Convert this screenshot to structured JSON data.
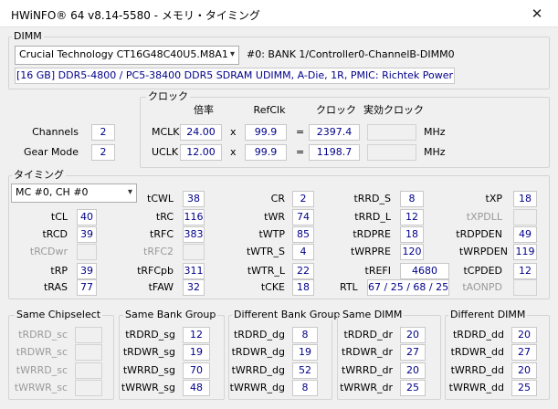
{
  "window": {
    "title": "HWiNFO® 64 v8.14-5580 - メモリ・タイミング",
    "close_glyph": "✕"
  },
  "dimm": {
    "label": "DIMM",
    "selected_module": "Crucial Technology CT16G48C40U5.M8A1",
    "location": "#0: BANK 1/Controller0-ChannelB-DIMM0",
    "description": "[16 GB] DDR5-4800 / PC5-38400 DDR5 SDRAM UDIMM, A-Die, 1R, PMIC: Richtek Power"
  },
  "general": {
    "channels_label": "Channels",
    "channels_value": "2",
    "gear_label": "Gear Mode",
    "gear_value": "2"
  },
  "clock": {
    "label": "クロック",
    "head_mult": "倍率",
    "head_ref": "RefClk",
    "head_clock": "クロック",
    "head_eff": "実効クロック",
    "x_sign": "x",
    "eq_sign": "=",
    "mclk_label": "MCLK",
    "mclk_mult": "24.00",
    "mclk_ref": "99.9",
    "mclk_clock": "2397.4",
    "mclk_unit": "MHz",
    "uclk_label": "UCLK",
    "uclk_mult": "12.00",
    "uclk_ref": "99.9",
    "uclk_clock": "1198.7",
    "uclk_unit": "MHz"
  },
  "timing": {
    "label": "タイミング",
    "channel_select": "MC #0, CH #0",
    "tCL": "40",
    "tRCD": "39",
    "tRCDwr": "",
    "tRP": "39",
    "tRAS": "77",
    "tCWL": "38",
    "tRC": "116",
    "tRFC": "383",
    "tRFC2": "",
    "tRFCpb": "311",
    "tFAW": "32",
    "CR": "2",
    "tWR": "74",
    "tWTP": "85",
    "tWTR_S": "4",
    "tWTR_L": "22",
    "tCKE": "18",
    "tRRD_S": "8",
    "tRRD_L": "12",
    "tRDPRE": "18",
    "tWRPRE": "120",
    "tREFI": "4680",
    "RTL": "67 / 25 / 68 / 25",
    "tXP": "18",
    "tXPDLL": "",
    "tRDPDEN": "49",
    "tWRPDEN": "119",
    "tCPDED": "12",
    "tAONPD": ""
  },
  "same_chipselect": {
    "label": "Same Chipselect",
    "tRDRD_sc": "",
    "tRDWR_sc": "",
    "tWRRD_sc": "",
    "tWRWR_sc": ""
  },
  "same_bank_group": {
    "label": "Same Bank Group",
    "tRDRD_sg": "12",
    "tRDWR_sg": "19",
    "tWRRD_sg": "70",
    "tWRWR_sg": "48"
  },
  "diff_bank_group": {
    "label": "Different Bank Group",
    "tRDRD_dg": "8",
    "tRDWR_dg": "19",
    "tWRRD_dg": "52",
    "tWRWR_dg": "8"
  },
  "same_dimm": {
    "label": "Same DIMM",
    "tRDRD_dr": "20",
    "tRDWR_dr": "27",
    "tWRRD_dr": "20",
    "tWRWR_dr": "25"
  },
  "diff_dimm": {
    "label": "Different DIMM",
    "tRDRD_dd": "20",
    "tRDWR_dd": "27",
    "tWRRD_dd": "20",
    "tWRWR_dd": "25"
  },
  "labels": {
    "tCL": "tCL",
    "tRCD": "tRCD",
    "tRCDwr": "tRCDwr",
    "tRP": "tRP",
    "tRAS": "tRAS",
    "tCWL": "tCWL",
    "tRC": "tRC",
    "tRFC": "tRFC",
    "tRFC2": "tRFC2",
    "tRFCpb": "tRFCpb",
    "tFAW": "tFAW",
    "CR": "CR",
    "tWR": "tWR",
    "tWTP": "tWTP",
    "tWTR_S": "tWTR_S",
    "tWTR_L": "tWTR_L",
    "tCKE": "tCKE",
    "tRRD_S": "tRRD_S",
    "tRRD_L": "tRRD_L",
    "tRDPRE": "tRDPRE",
    "tWRPRE": "tWRPRE",
    "tREFI": "tREFI",
    "RTL": "RTL",
    "tXP": "tXP",
    "tXPDLL": "tXPDLL",
    "tRDPDEN": "tRDPDEN",
    "tWRPDEN": "tWRPDEN",
    "tCPDED": "tCPDED",
    "tAONPD": "tAONPD",
    "tRDRD_sc": "tRDRD_sc",
    "tRDWR_sc": "tRDWR_sc",
    "tWRRD_sc": "tWRRD_sc",
    "tWRWR_sc": "tWRWR_sc",
    "tRDRD_sg": "tRDRD_sg",
    "tRDWR_sg": "tRDWR_sg",
    "tWRRD_sg": "tWRRD_sg",
    "tWRWR_sg": "tWRWR_sg",
    "tRDRD_dg": "tRDRD_dg",
    "tRDWR_dg": "tRDWR_dg",
    "tWRRD_dg": "tWRRD_dg",
    "tWRWR_dg": "tWRWR_dg",
    "tRDRD_dr": "tRDRD_dr",
    "tRDWR_dr": "tRDWR_dr",
    "tWRRD_dr": "tWRRD_dr",
    "tWRWR_dr": "tWRWR_dr",
    "tRDRD_dd": "tRDRD_dd",
    "tRDWR_dd": "tRDWR_dd",
    "tWRRD_dd": "tWRRD_dd",
    "tWRWR_dd": "tWRWR_dd"
  }
}
